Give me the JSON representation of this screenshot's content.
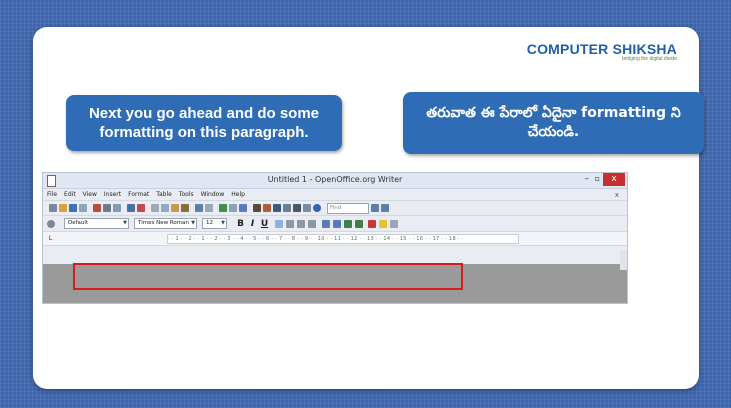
{
  "logo": {
    "main": "COMPUTER SHIKSHA",
    "tagline": "bridging the digital divide"
  },
  "callout_english": "Next you go ahead and do some formatting on this paragraph.",
  "callout_telugu": "తరువాత ఈ పేరాలో ఏదైనా formatting ని చేయండి.",
  "window": {
    "title": "Untitled 1 - OpenOffice.org Writer",
    "menu": [
      "File",
      "Edit",
      "View",
      "Insert",
      "Format",
      "Table",
      "Tools",
      "Window",
      "Help"
    ],
    "menu_close": "x"
  },
  "toolbar": {
    "find_placeholder": "Find"
  },
  "format_bar": {
    "style": "Default",
    "font": "Times New Roman",
    "size": "12",
    "bold": "B",
    "italic": "I",
    "underline": "U"
  },
  "ruler": "· · 1 · · 2 · · 1 · · 2 · · 3 · · 4 · · 5 · · 6 · · 7 · · 8 · · 9 · · 10 · · 11 · · 12 · · 13 · · 14 · · 15 · · 16 · · 17 · · 18 · ·",
  "colors": {
    "background": "#3f66ad",
    "callout": "#2e6db5",
    "highlight": "#d81b21",
    "logo": "#1f5fa8"
  }
}
